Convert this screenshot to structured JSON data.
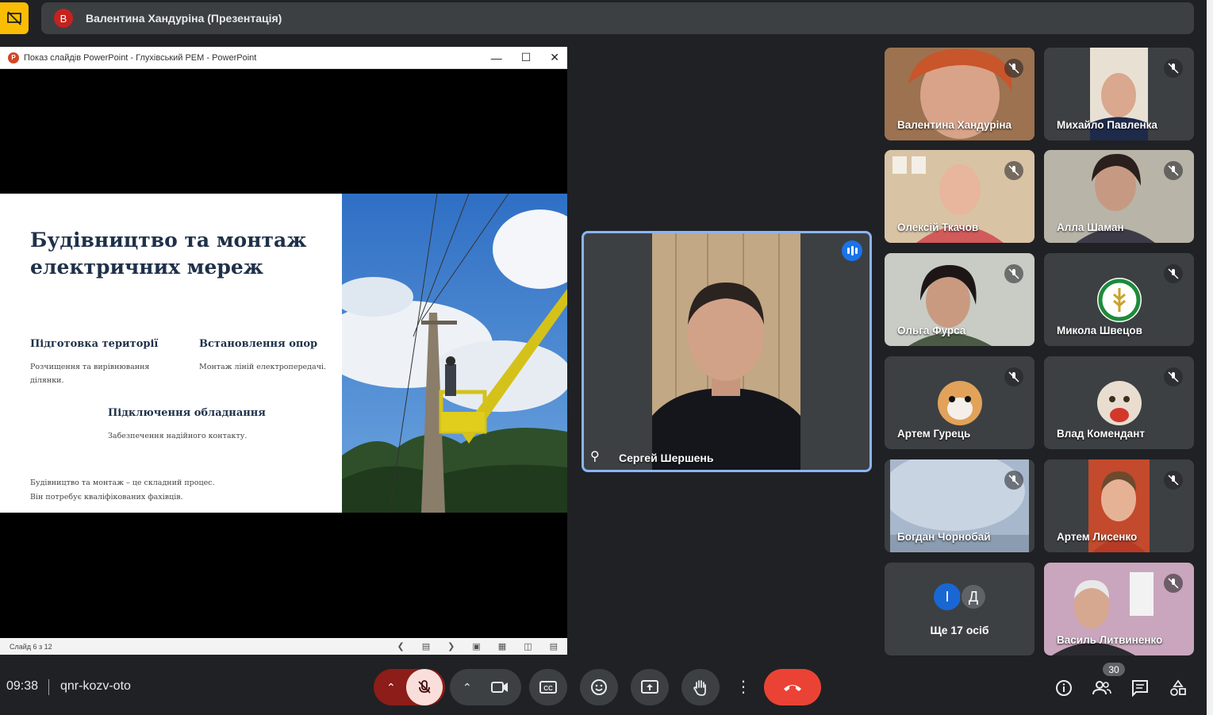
{
  "topbar": {
    "presenter_initial": "В",
    "presentation_title": "Валентина Хандуріна (Презентація)"
  },
  "ppt": {
    "window_title": "Показ слайдів PowerPoint  -  Глухівський РЕМ - PowerPoint",
    "slide": {
      "title": "Будівництво та монтаж електричних мереж",
      "section1_heading": "Підготовка території",
      "section1_text": "Розчищення та вирівнювання ділянки.",
      "section2_heading": "Встановлення опор",
      "section2_text": "Монтаж ліній електропередачі.",
      "section3_heading": "Підключення обладнання",
      "section3_text": "Забезпечення надійного контакту.",
      "footer_line1": "Будівництво та монтаж – це складний процес.",
      "footer_line2": "Він потребує кваліфікованих фахівців."
    },
    "status_text": "Слайд 6 з 12"
  },
  "speaker": {
    "name": "Сергей Шершень"
  },
  "participants": [
    {
      "name": "Валентина Хандуріна"
    },
    {
      "name": "Михайло Павленка"
    },
    {
      "name": "Олексій Ткачов"
    },
    {
      "name": "Алла Шаман"
    },
    {
      "name": "Ольга Фурса"
    },
    {
      "name": "Микола Швецов"
    },
    {
      "name": "Артем Гурець"
    },
    {
      "name": "Влад Комендант"
    },
    {
      "name": "Богдан Чорнобай"
    },
    {
      "name": "Артем Лисенко"
    },
    {
      "name": "Василь Литвиненко"
    }
  ],
  "others": {
    "initial1": "І",
    "initial2": "Д",
    "label": "Ще 17 осіб"
  },
  "bottom": {
    "time": "09:38",
    "meeting_code": "qnr-kozv-oto",
    "participant_count": "30"
  },
  "colors": {
    "background": "#202124",
    "tile": "#3c4043",
    "accent": "#8ab4f8",
    "end_call": "#ea4335",
    "presenting": "#fbbc04"
  }
}
